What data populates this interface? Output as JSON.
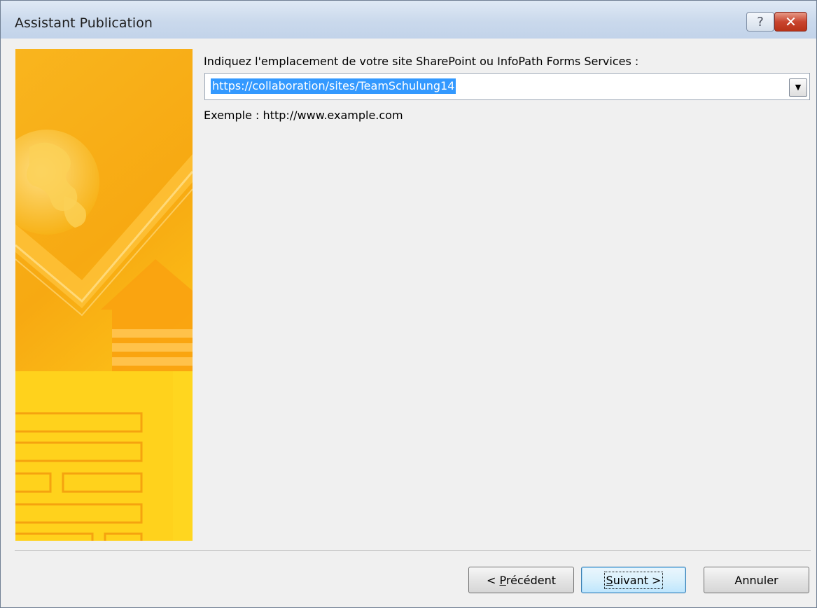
{
  "window": {
    "title": "Assistant Publication"
  },
  "titlebar": {
    "help_label": "?",
    "close_label": "✕"
  },
  "form": {
    "prompt": "Indiquez l'emplacement de votre site SharePoint ou InfoPath Forms Services :",
    "location_value": "https://collaboration/sites/TeamSchulung14",
    "example": "Exemple : http://www.example.com"
  },
  "buttons": {
    "previous": {
      "prefix": "< ",
      "mnemonic": "P",
      "rest": "récédent"
    },
    "next": {
      "mnemonic": "S",
      "rest": "uivant >"
    },
    "cancel": "Annuler"
  },
  "colors": {
    "banner_orange": "#f5a814",
    "banner_yellow": "#ffd21c",
    "selection": "#3399ff"
  }
}
